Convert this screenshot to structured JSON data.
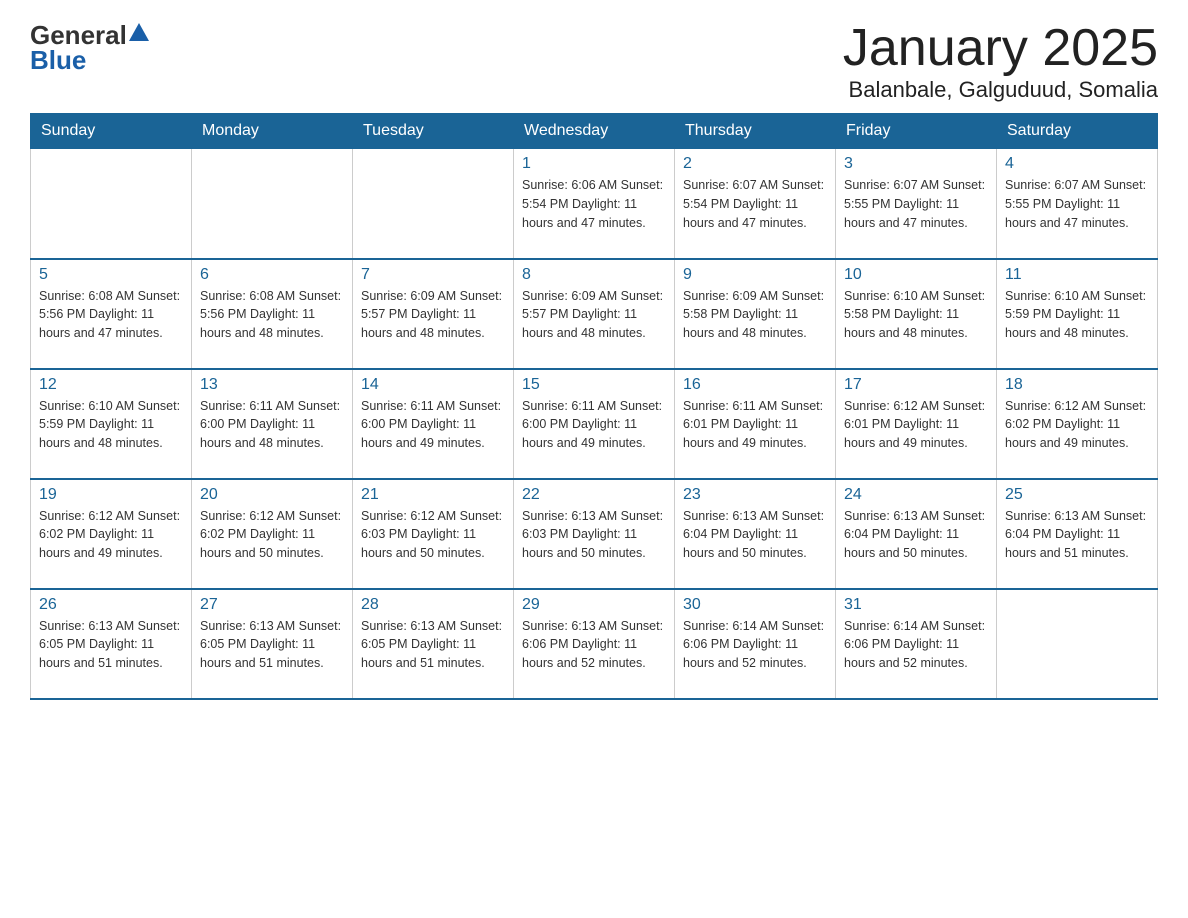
{
  "logo": {
    "general": "General",
    "blue": "Blue"
  },
  "title": "January 2025",
  "location": "Balanbale, Galguduud, Somalia",
  "headers": [
    "Sunday",
    "Monday",
    "Tuesday",
    "Wednesday",
    "Thursday",
    "Friday",
    "Saturday"
  ],
  "weeks": [
    [
      {
        "day": "",
        "info": ""
      },
      {
        "day": "",
        "info": ""
      },
      {
        "day": "",
        "info": ""
      },
      {
        "day": "1",
        "info": "Sunrise: 6:06 AM\nSunset: 5:54 PM\nDaylight: 11 hours and 47 minutes."
      },
      {
        "day": "2",
        "info": "Sunrise: 6:07 AM\nSunset: 5:54 PM\nDaylight: 11 hours and 47 minutes."
      },
      {
        "day": "3",
        "info": "Sunrise: 6:07 AM\nSunset: 5:55 PM\nDaylight: 11 hours and 47 minutes."
      },
      {
        "day": "4",
        "info": "Sunrise: 6:07 AM\nSunset: 5:55 PM\nDaylight: 11 hours and 47 minutes."
      }
    ],
    [
      {
        "day": "5",
        "info": "Sunrise: 6:08 AM\nSunset: 5:56 PM\nDaylight: 11 hours and 47 minutes."
      },
      {
        "day": "6",
        "info": "Sunrise: 6:08 AM\nSunset: 5:56 PM\nDaylight: 11 hours and 48 minutes."
      },
      {
        "day": "7",
        "info": "Sunrise: 6:09 AM\nSunset: 5:57 PM\nDaylight: 11 hours and 48 minutes."
      },
      {
        "day": "8",
        "info": "Sunrise: 6:09 AM\nSunset: 5:57 PM\nDaylight: 11 hours and 48 minutes."
      },
      {
        "day": "9",
        "info": "Sunrise: 6:09 AM\nSunset: 5:58 PM\nDaylight: 11 hours and 48 minutes."
      },
      {
        "day": "10",
        "info": "Sunrise: 6:10 AM\nSunset: 5:58 PM\nDaylight: 11 hours and 48 minutes."
      },
      {
        "day": "11",
        "info": "Sunrise: 6:10 AM\nSunset: 5:59 PM\nDaylight: 11 hours and 48 minutes."
      }
    ],
    [
      {
        "day": "12",
        "info": "Sunrise: 6:10 AM\nSunset: 5:59 PM\nDaylight: 11 hours and 48 minutes."
      },
      {
        "day": "13",
        "info": "Sunrise: 6:11 AM\nSunset: 6:00 PM\nDaylight: 11 hours and 48 minutes."
      },
      {
        "day": "14",
        "info": "Sunrise: 6:11 AM\nSunset: 6:00 PM\nDaylight: 11 hours and 49 minutes."
      },
      {
        "day": "15",
        "info": "Sunrise: 6:11 AM\nSunset: 6:00 PM\nDaylight: 11 hours and 49 minutes."
      },
      {
        "day": "16",
        "info": "Sunrise: 6:11 AM\nSunset: 6:01 PM\nDaylight: 11 hours and 49 minutes."
      },
      {
        "day": "17",
        "info": "Sunrise: 6:12 AM\nSunset: 6:01 PM\nDaylight: 11 hours and 49 minutes."
      },
      {
        "day": "18",
        "info": "Sunrise: 6:12 AM\nSunset: 6:02 PM\nDaylight: 11 hours and 49 minutes."
      }
    ],
    [
      {
        "day": "19",
        "info": "Sunrise: 6:12 AM\nSunset: 6:02 PM\nDaylight: 11 hours and 49 minutes."
      },
      {
        "day": "20",
        "info": "Sunrise: 6:12 AM\nSunset: 6:02 PM\nDaylight: 11 hours and 50 minutes."
      },
      {
        "day": "21",
        "info": "Sunrise: 6:12 AM\nSunset: 6:03 PM\nDaylight: 11 hours and 50 minutes."
      },
      {
        "day": "22",
        "info": "Sunrise: 6:13 AM\nSunset: 6:03 PM\nDaylight: 11 hours and 50 minutes."
      },
      {
        "day": "23",
        "info": "Sunrise: 6:13 AM\nSunset: 6:04 PM\nDaylight: 11 hours and 50 minutes."
      },
      {
        "day": "24",
        "info": "Sunrise: 6:13 AM\nSunset: 6:04 PM\nDaylight: 11 hours and 50 minutes."
      },
      {
        "day": "25",
        "info": "Sunrise: 6:13 AM\nSunset: 6:04 PM\nDaylight: 11 hours and 51 minutes."
      }
    ],
    [
      {
        "day": "26",
        "info": "Sunrise: 6:13 AM\nSunset: 6:05 PM\nDaylight: 11 hours and 51 minutes."
      },
      {
        "day": "27",
        "info": "Sunrise: 6:13 AM\nSunset: 6:05 PM\nDaylight: 11 hours and 51 minutes."
      },
      {
        "day": "28",
        "info": "Sunrise: 6:13 AM\nSunset: 6:05 PM\nDaylight: 11 hours and 51 minutes."
      },
      {
        "day": "29",
        "info": "Sunrise: 6:13 AM\nSunset: 6:06 PM\nDaylight: 11 hours and 52 minutes."
      },
      {
        "day": "30",
        "info": "Sunrise: 6:14 AM\nSunset: 6:06 PM\nDaylight: 11 hours and 52 minutes."
      },
      {
        "day": "31",
        "info": "Sunrise: 6:14 AM\nSunset: 6:06 PM\nDaylight: 11 hours and 52 minutes."
      },
      {
        "day": "",
        "info": ""
      }
    ]
  ]
}
